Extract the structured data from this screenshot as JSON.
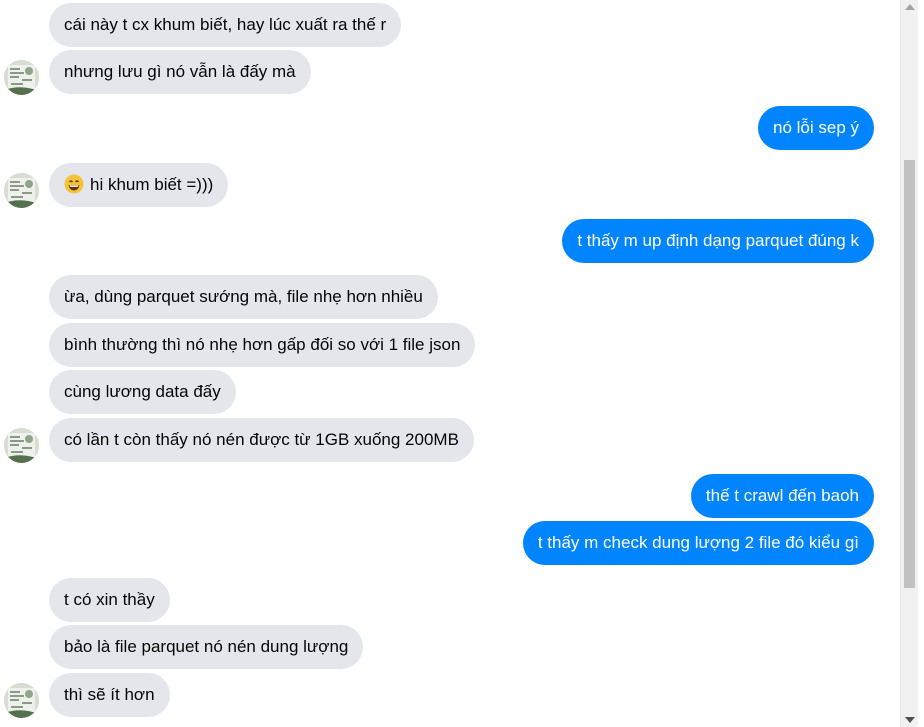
{
  "messages": [
    {
      "from": "other",
      "text": "cái này t cx khum biết, hay lúc xuất ra thế r"
    },
    {
      "from": "other",
      "text": "nhưng lưu gì nó vẫn là đấy mà"
    },
    {
      "from": "me",
      "text": "nó lỗi sep ý"
    },
    {
      "from": "other",
      "text": "hi khum biết =)))",
      "emoji": "grinning-face-emoji"
    },
    {
      "from": "me",
      "text": "t thấy m up định dạng parquet đúng k"
    },
    {
      "from": "other",
      "text": "ừa, dùng parquet sướng mà, file nhẹ hơn nhiều"
    },
    {
      "from": "other",
      "text": "bình thường thì nó nhẹ hơn gấp đối so với 1 file json"
    },
    {
      "from": "other",
      "text": "cùng lương data đấy"
    },
    {
      "from": "other",
      "text": "có lần t còn thấy nó nén được từ 1GB xuống 200MB"
    },
    {
      "from": "me",
      "text": "thế t crawl đến baoh"
    },
    {
      "from": "me",
      "text": "t thấy m check dung lượng 2 file đó kiểu gì"
    },
    {
      "from": "other",
      "text": "t có xin thầy"
    },
    {
      "from": "other",
      "text": "bảo là file parquet nó nén dung lượng"
    },
    {
      "from": "other",
      "text": "thì sẽ ít hơn"
    }
  ],
  "colors": {
    "incoming_bubble": "#e4e6eb",
    "outgoing_bubble": "#0084ff",
    "incoming_text": "#050505",
    "outgoing_text": "#ffffff"
  }
}
